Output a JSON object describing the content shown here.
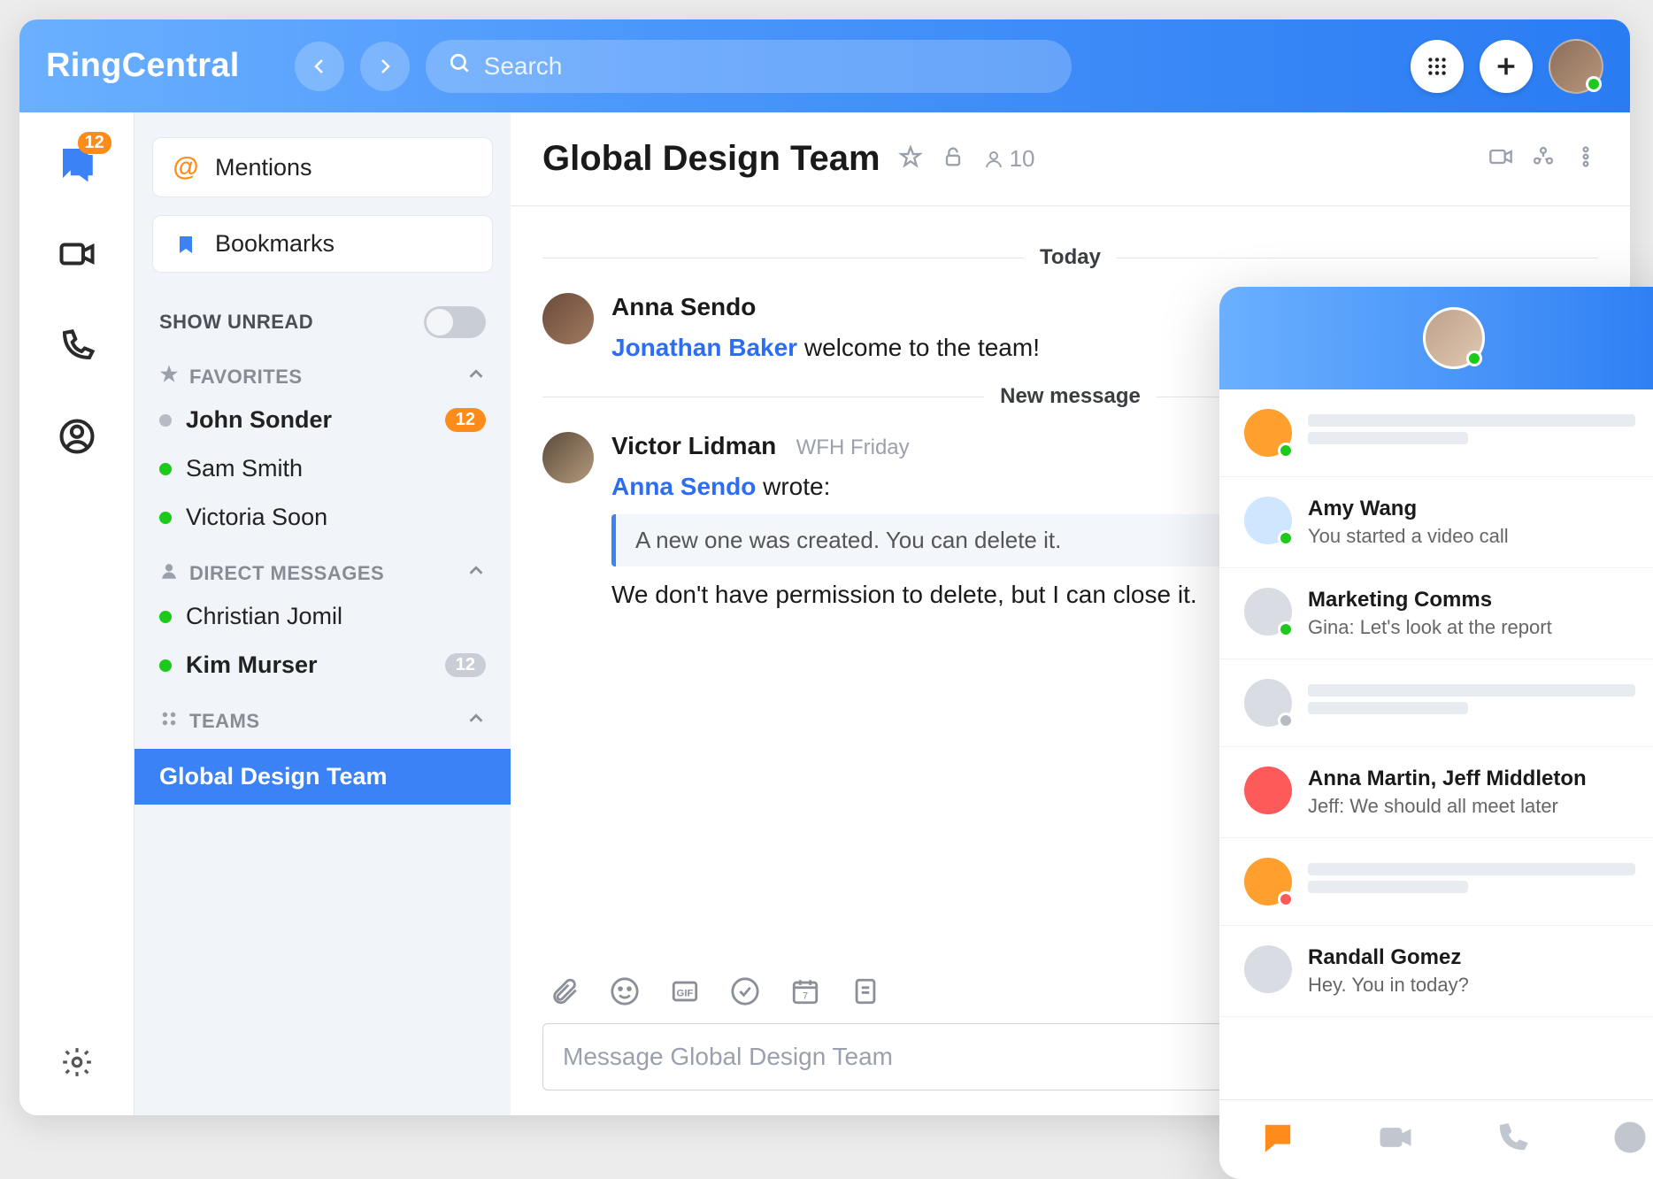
{
  "brand": "RingCentral",
  "search": {
    "placeholder": "Search"
  },
  "rail": {
    "chat_badge": "12"
  },
  "sidebar": {
    "mentions_label": "Mentions",
    "bookmarks_label": "Bookmarks",
    "show_unread_label": "SHOW UNREAD",
    "favorites_label": "FAVORITES",
    "dm_label": "DIRECT MESSAGES",
    "teams_label": "TEAMS",
    "favorites": [
      {
        "name": "John Sonder",
        "presence": "gray",
        "bold": true,
        "badge": "12"
      },
      {
        "name": "Sam Smith",
        "presence": "green"
      },
      {
        "name": "Victoria Soon",
        "presence": "green"
      }
    ],
    "dms": [
      {
        "name": "Christian Jomil",
        "presence": "green"
      },
      {
        "name": "Kim Murser",
        "presence": "green",
        "bold": true,
        "badge": "12",
        "badge_muted": true
      }
    ],
    "teams": [
      {
        "name": "Global Design Team",
        "active": true
      }
    ]
  },
  "chat": {
    "title": "Global Design Team",
    "member_count": "10",
    "today_label": "Today",
    "newmsg_label": "New message",
    "msg1": {
      "sender": "Anna Sendo",
      "mention": "Jonathan Baker",
      "tail": " welcome to the team!"
    },
    "msg2": {
      "sender": "Victor Lidman",
      "meta": "WFH Friday",
      "ref": "Anna Sendo",
      "ref_tail": " wrote:",
      "quote": "A new one was created. You can delete it.",
      "body": "We don't have permission to delete, but I can close it."
    },
    "composer_placeholder": "Message Global Design Team"
  },
  "mobile": {
    "rows": [
      {
        "skeleton": true,
        "color": "#ff9f2e",
        "presence": "#1ec91e"
      },
      {
        "name": "Amy Wang",
        "sub": "You started a video call",
        "color": "#cfe6ff",
        "presence": "#1ec91e"
      },
      {
        "name": "Marketing Comms",
        "sub": "Gina: Let's look at the report",
        "color": "#d9dde3",
        "presence": "#1ec91e"
      },
      {
        "skeleton": true,
        "color": "#d9dde3",
        "presence": "#b7bcc4"
      },
      {
        "name": "Anna Martin, Jeff Middleton",
        "sub": "Jeff: We should all meet later",
        "color": "#ff5a5a",
        "presence": null
      },
      {
        "skeleton": true,
        "color": "#ff9f2e",
        "presence": "#ff5a5a"
      },
      {
        "name": "Randall Gomez",
        "sub": "Hey. You in today?",
        "color": "#d9dde3",
        "presence": null
      }
    ]
  }
}
